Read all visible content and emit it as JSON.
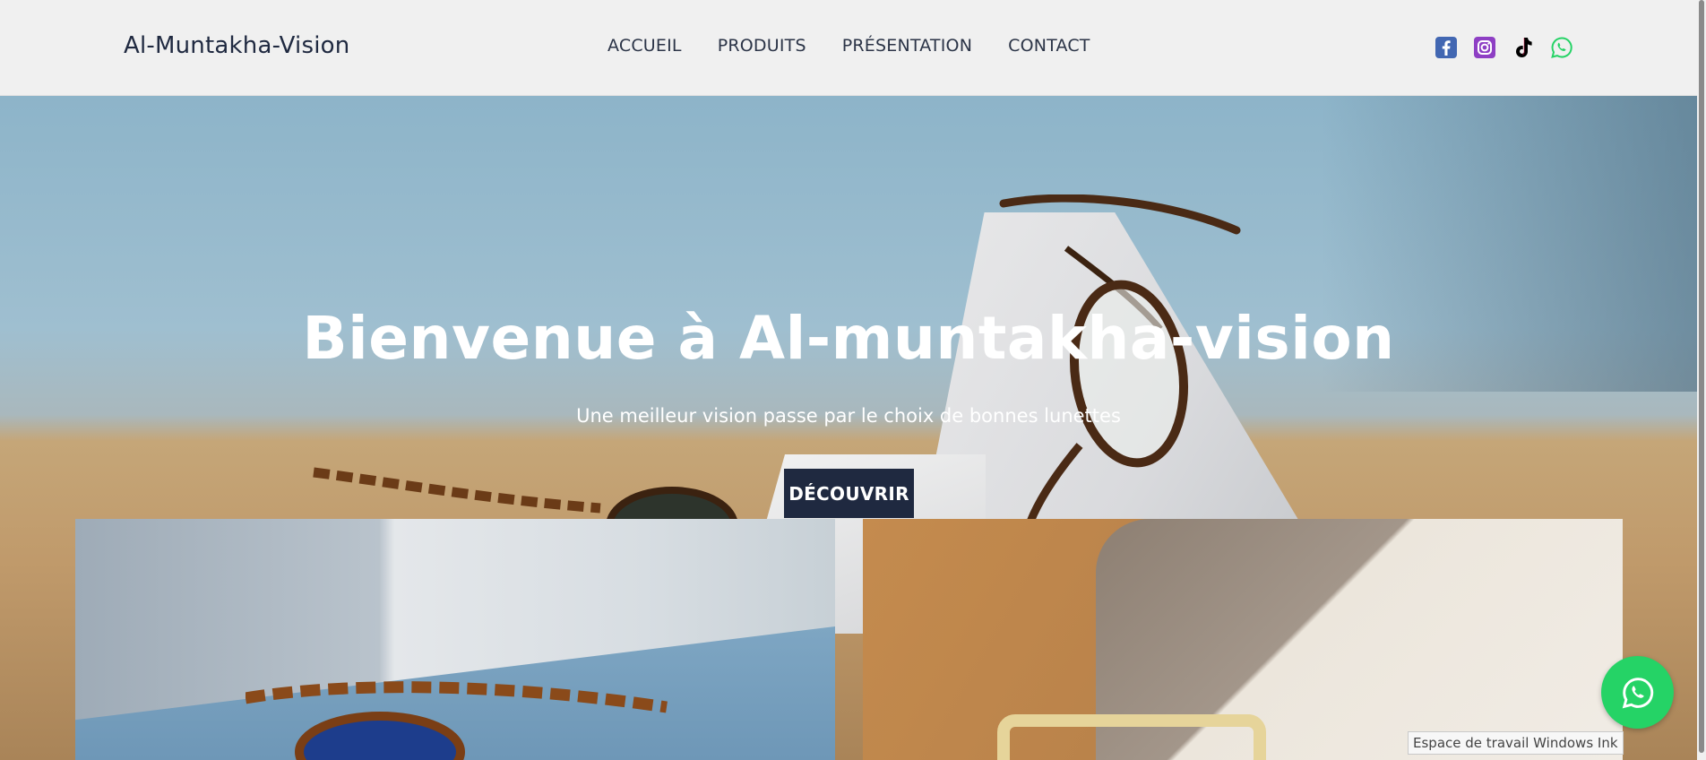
{
  "header": {
    "brand": "Al-Muntakha-Vision",
    "nav": [
      {
        "label": "ACCUEIL"
      },
      {
        "label": "PRODUITS"
      },
      {
        "label": "PRÉSENTATION"
      },
      {
        "label": "CONTACT"
      }
    ],
    "socials": [
      {
        "icon": "facebook-icon",
        "color": "#4267b2"
      },
      {
        "icon": "instagram-icon",
        "color": "#8e3fc4"
      },
      {
        "icon": "tiktok-icon",
        "color": "#000000"
      },
      {
        "icon": "whatsapp-icon",
        "color": "#25d366"
      }
    ]
  },
  "hero": {
    "title": "Bienvenue à Al-muntakha-vision",
    "subtitle": "Une meilleur vision passe par le choix de bonnes lunettes",
    "cta_label": "DÉCOUVRIR"
  },
  "floating": {
    "icon": "whatsapp-icon",
    "color": "#25d366"
  },
  "tooltip": {
    "text": "Espace de travail Windows Ink"
  },
  "colors": {
    "brand_dark": "#1f2940",
    "header_bg": "#f0f0f0"
  }
}
